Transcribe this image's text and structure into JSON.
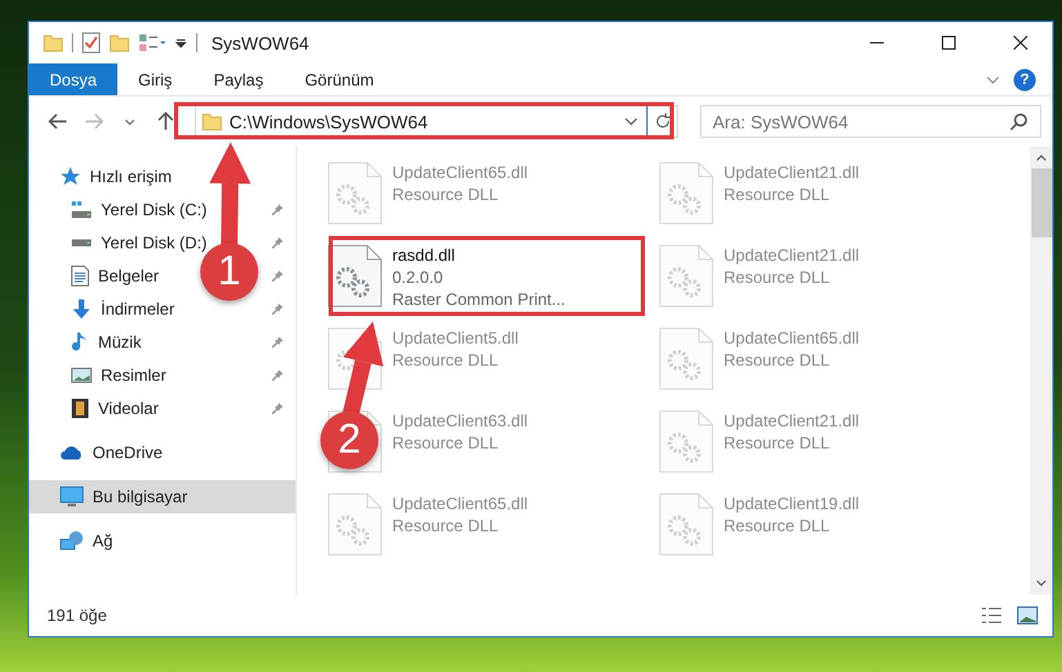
{
  "window": {
    "title": "SysWOW64"
  },
  "ribbon": {
    "tabs": [
      {
        "label": "Dosya",
        "kind": "file"
      },
      {
        "label": "Giriş",
        "kind": "tab"
      },
      {
        "label": "Paylaş",
        "kind": "tab"
      },
      {
        "label": "Görünüm",
        "kind": "tab"
      }
    ],
    "help": "?"
  },
  "navigation": {
    "back": {
      "disabled": false
    },
    "forward": {
      "disabled": true
    },
    "address": "C:\\Windows\\SysWOW64",
    "search": {
      "placeholder": "Ara: SysWOW64"
    }
  },
  "sidebar": {
    "items": [
      {
        "label": "Hızlı erişim",
        "kind": "star",
        "selected": false,
        "children": [
          {
            "label": "Yerel Disk (C:)",
            "kind": "system-drive",
            "pinned": true,
            "selected": false
          },
          {
            "label": "Yerel Disk (D:)",
            "kind": "drive",
            "pinned": true,
            "selected": false
          },
          {
            "label": "Belgeler",
            "kind": "documents",
            "pinned": true,
            "selected": false
          },
          {
            "label": "İndirmeler",
            "kind": "downloads",
            "pinned": true,
            "selected": false
          },
          {
            "label": "Müzik",
            "kind": "music",
            "pinned": true,
            "selected": false
          },
          {
            "label": "Resimler",
            "kind": "pictures",
            "pinned": true,
            "selected": false
          },
          {
            "label": "Videolar",
            "kind": "videos",
            "pinned": true,
            "selected": false
          }
        ]
      },
      {
        "label": "OneDrive",
        "kind": "cloud",
        "selected": false
      },
      {
        "label": "Bu bilgisayar",
        "kind": "computer",
        "selected": true
      },
      {
        "label": "Ağ",
        "kind": "network",
        "selected": false
      }
    ]
  },
  "files": [
    {
      "name": "UpdateClient65.dll",
      "details": [
        "Resource DLL"
      ],
      "faded": true
    },
    {
      "name": "UpdateClient21.dll",
      "details": [
        "Resource DLL"
      ],
      "faded": true
    },
    {
      "name": "rasdd.dll",
      "details": [
        "0.2.0.0",
        "Raster Common Print..."
      ],
      "faded": false
    },
    {
      "name": "UpdateClient21.dll",
      "details": [
        "Resource DLL"
      ],
      "faded": true
    },
    {
      "name": "UpdateClient5.dll",
      "details": [
        "Resource DLL"
      ],
      "faded": true
    },
    {
      "name": "UpdateClient65.dll",
      "details": [
        "Resource DLL"
      ],
      "faded": true
    },
    {
      "name": "UpdateClient63.dll",
      "details": [
        "Resource DLL"
      ],
      "faded": true
    },
    {
      "name": "UpdateClient21.dll",
      "details": [
        "Resource DLL"
      ],
      "faded": true
    },
    {
      "name": "UpdateClient65.dll",
      "details": [
        "Resource DLL"
      ],
      "faded": true
    },
    {
      "name": "UpdateClient19.dll",
      "details": [
        "Resource DLL"
      ],
      "faded": true
    }
  ],
  "status_bar": {
    "count": "191 öğe"
  },
  "annotations": [
    {
      "number": "1"
    },
    {
      "number": "2"
    }
  ]
}
